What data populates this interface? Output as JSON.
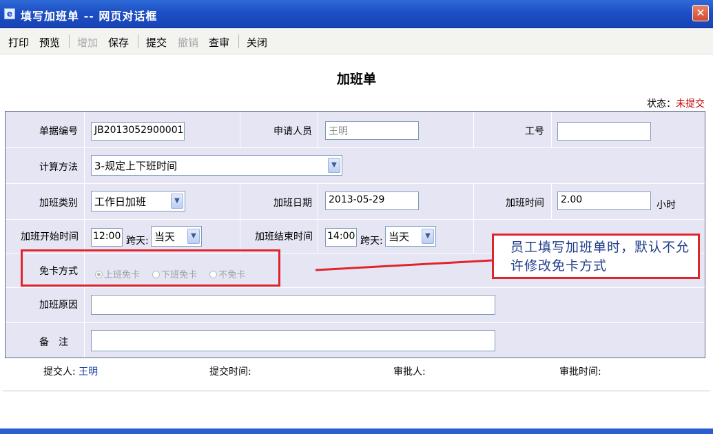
{
  "window": {
    "title": "填写加班单 -- 网页对话框",
    "app_icon": "ie-page-icon",
    "close_glyph": "✕"
  },
  "toolbar": {
    "items": [
      {
        "label": "打印",
        "enabled": true
      },
      {
        "label": "预览",
        "enabled": true
      },
      {
        "label": "增加",
        "enabled": false
      },
      {
        "label": "保存",
        "enabled": true
      },
      {
        "label": "提交",
        "enabled": true
      },
      {
        "label": "撤销",
        "enabled": false
      },
      {
        "label": "查审",
        "enabled": true
      },
      {
        "label": "关闭",
        "enabled": true
      }
    ]
  },
  "page": {
    "title": "加班单",
    "status_label": "状态：",
    "status_value": "未提交"
  },
  "form": {
    "doc_no_label": "单据编号",
    "doc_no_value": "JB2013052900001",
    "applicant_label": "申请人员",
    "applicant_value": "王明",
    "emp_no_label": "工号",
    "emp_no_value": "",
    "calc_method_label": "计算方法",
    "calc_method_value": "3-规定上下班时间",
    "ot_type_label": "加班类别",
    "ot_type_value": "工作日加班",
    "ot_date_label": "加班日期",
    "ot_date_value": "2013-05-29",
    "ot_hours_label": "加班时间",
    "ot_hours_value": "2.00",
    "ot_hours_unit": "小时",
    "start_label": "加班开始时间",
    "start_time": "12:00",
    "start_cross_label": "跨天:",
    "start_cross_value": "当天",
    "end_label": "加班结束时间",
    "end_time": "14:00",
    "end_cross_label": "跨天:",
    "end_cross_value": "当天",
    "exempt_label": "免卡方式",
    "exempt_options": [
      "上班免卡",
      "下班免卡",
      "不免卡"
    ],
    "exempt_selected": 0,
    "reason_label": "加班原因",
    "reason_value": "",
    "remark_label": "备　注",
    "remark_value": ""
  },
  "annotation": {
    "text": "员工填写加班单时，默认不允许修改免卡方式",
    "color": "#e0242c"
  },
  "footer": {
    "submitter_label": "提交人:",
    "submitter_value": "王明",
    "submit_time_label": "提交时间:",
    "approver_label": "审批人:",
    "approve_time_label": "审批时间:"
  }
}
